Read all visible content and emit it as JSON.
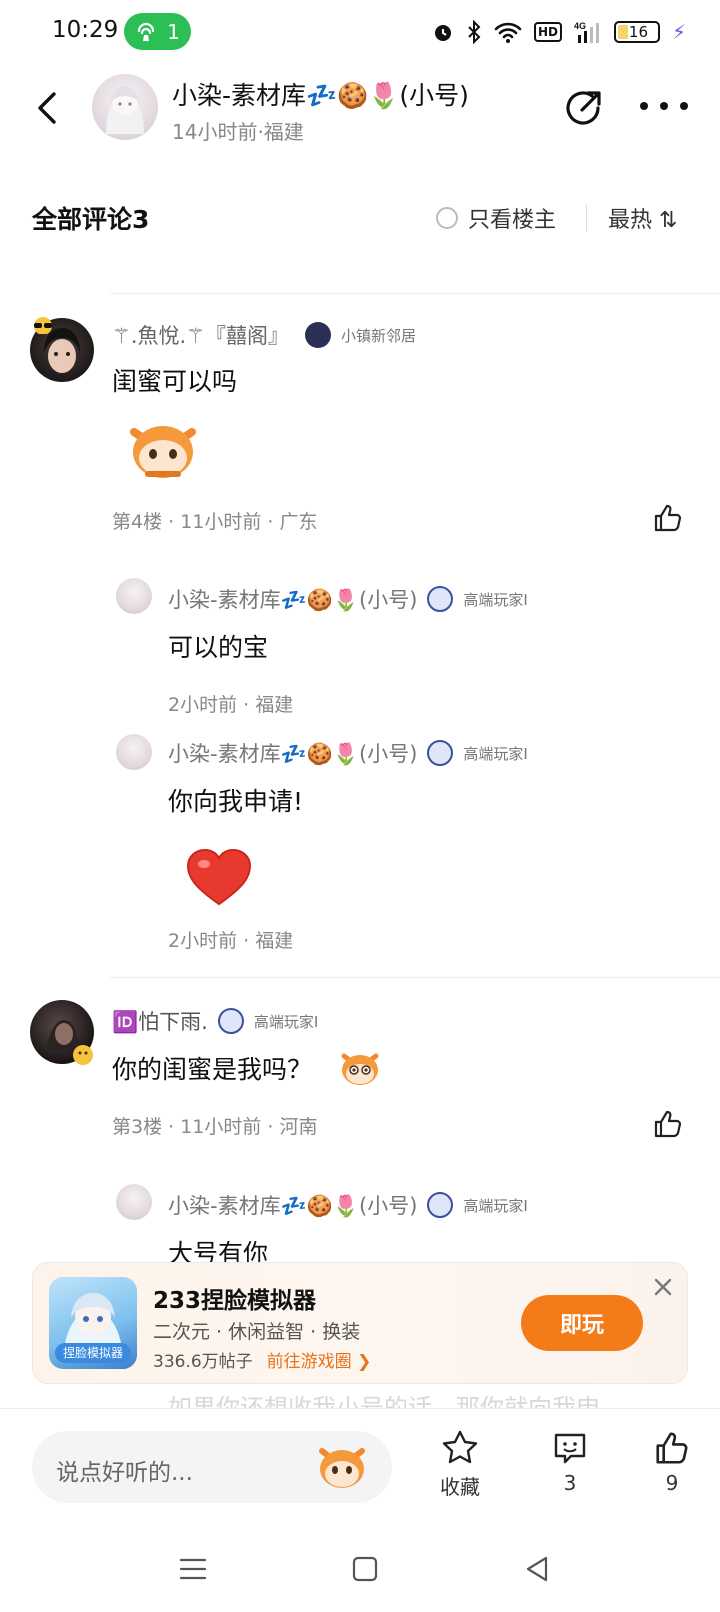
{
  "status_bar": {
    "time": "10:29",
    "hotspot_count": "1",
    "battery": "16",
    "network": "4G"
  },
  "header": {
    "title": "小染-素材库💤🍪🌷(小号)",
    "subtitle": "14小时前·福建"
  },
  "comments_header": {
    "title": "全部评论3",
    "only_host": "只看楼主",
    "sort": "最热 ⇅"
  },
  "comments": [
    {
      "author": "⚚.魚悅.⚚『囍阁』",
      "badge": "小镇新邻居",
      "text": "闺蜜可以吗",
      "meta": "第4楼 · 11小时前 · 广东",
      "replies": [
        {
          "author": "小染-素材库💤🍪🌷(小号)",
          "badge": "高端玩家Ⅰ",
          "text": "可以的宝",
          "meta": "2小时前 · 福建"
        },
        {
          "author": "小染-素材库💤🍪🌷(小号)",
          "badge": "高端玩家Ⅰ",
          "text": "你向我申请!",
          "meta": "2小时前 · 福建"
        }
      ]
    },
    {
      "author": "🆔怕下雨.",
      "badge": "高端玩家Ⅰ",
      "text": "你的闺蜜是我吗？",
      "meta": "第3楼 · 11小时前 · 河南",
      "replies": [
        {
          "author": "小染-素材库💤🍪🌷(小号)",
          "badge": "高端玩家Ⅰ",
          "text": "大号有你"
        }
      ]
    }
  ],
  "ad": {
    "title": "233捏脸模拟器",
    "tags": "二次元 · 休闲益智 · 换装",
    "posts": "336.6万帖子",
    "link": "前往游戏圈 ❯",
    "icon_label": "捏脸模拟器",
    "button": "即玩"
  },
  "partially_hidden_text": "如果你还想收我小号的话，那你就向我申",
  "bottom_bar": {
    "placeholder": "说点好听的...",
    "favorite": "收藏",
    "comment_count": "3",
    "like_count": "9"
  }
}
